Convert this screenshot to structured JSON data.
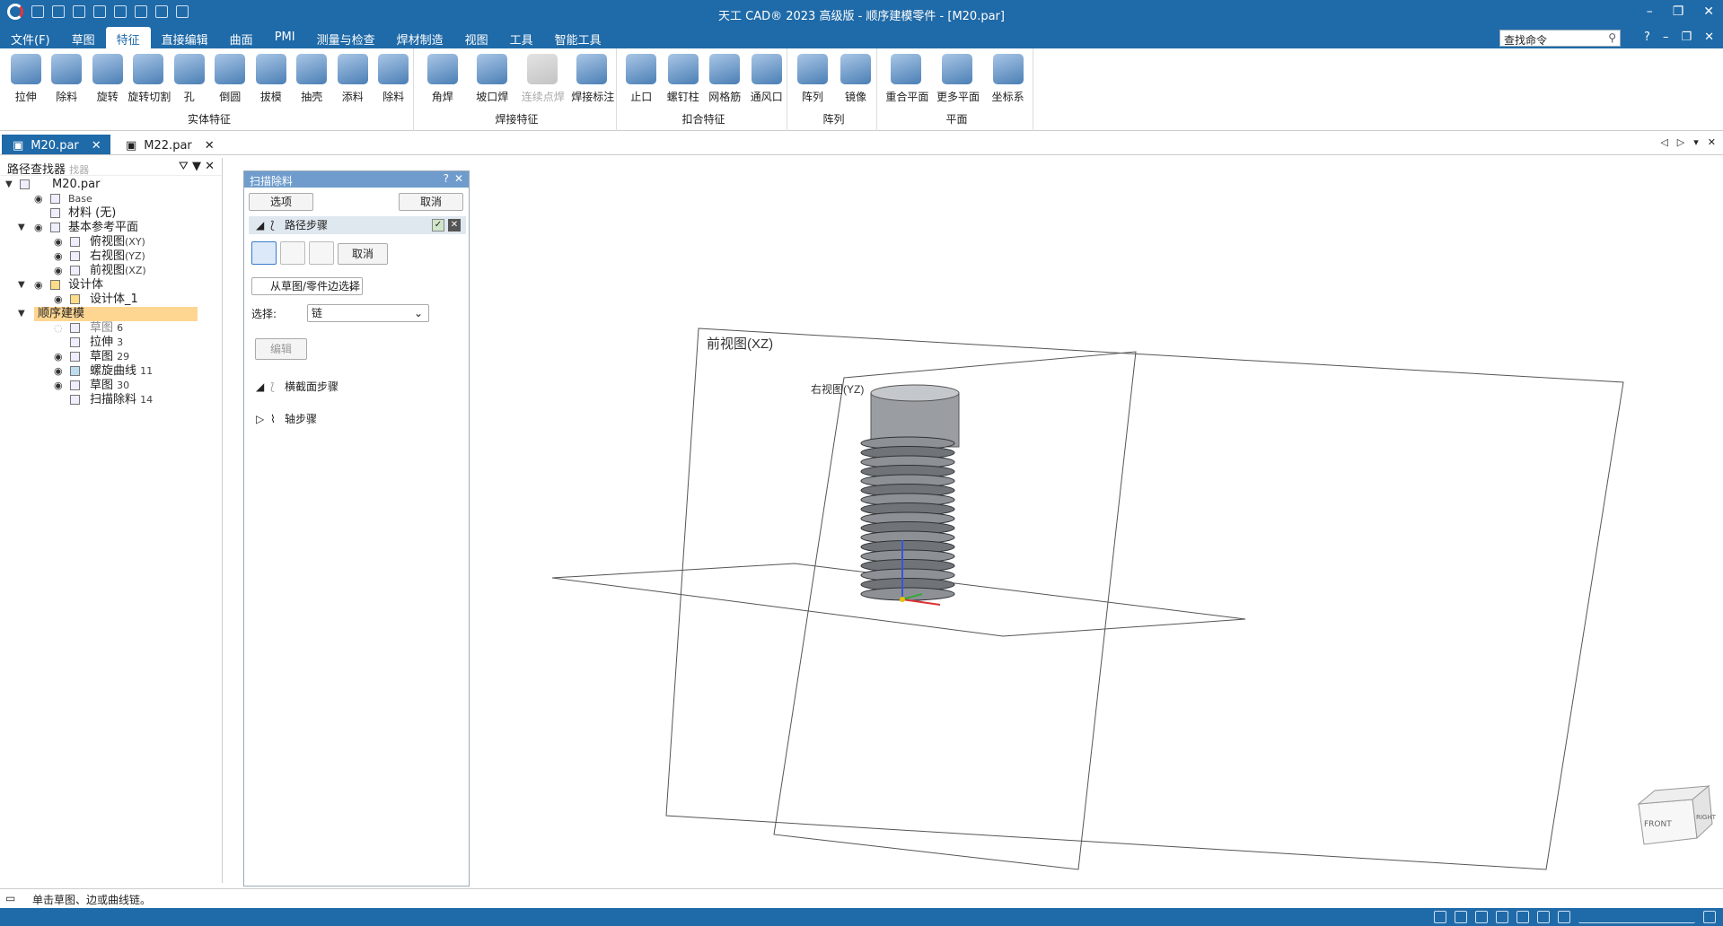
{
  "window": {
    "title": "天工 CAD® 2023 高级版 - 顺序建模零件 - [M20.par]",
    "controls": [
      "–",
      "❐",
      "✕"
    ]
  },
  "menu": {
    "items": [
      "文件(F)",
      "草图",
      "特征",
      "直接编辑",
      "曲面",
      "PMI",
      "测量与检查",
      "焊材制造",
      "视图",
      "工具",
      "智能工具"
    ],
    "active": "特征",
    "search_placeholder": "查找命令",
    "right": [
      "?",
      "–",
      "❐",
      "✕"
    ]
  },
  "ribbon": {
    "groups": [
      {
        "label": "实体特征",
        "tools": [
          "拉伸",
          "除料",
          "旋转",
          "旋转切割",
          "孔",
          "倒圆",
          "拔模",
          "抽壳",
          "添料",
          "除料"
        ]
      },
      {
        "label": "焊接特征",
        "tools": [
          "角焊",
          "坡口焊",
          "连续点焊",
          "焊接标注"
        ]
      },
      {
        "label": "扣合特征",
        "tools": [
          "止口",
          "螺钉柱",
          "网格筋",
          "通风口"
        ]
      },
      {
        "label": "阵列",
        "tools": [
          "阵列",
          "镜像"
        ]
      },
      {
        "label": "平面",
        "tools": [
          "重合平面",
          "更多平面",
          "坐标系"
        ]
      }
    ]
  },
  "doc_tabs": [
    {
      "label": "M20.par",
      "active": true
    },
    {
      "label": "M22.par",
      "active": false
    }
  ],
  "pathfinder": {
    "title": "路径查找器",
    "title_ghost": "找器",
    "tree": {
      "root": "M20.par",
      "base": "Base",
      "material": "材料 (无)",
      "ref_planes": "基本参考平面",
      "top_view": "俯视图",
      "top_view_sub": "(XY)",
      "right_view": "右视图",
      "right_view_sub": "(YZ)",
      "front_view": "前视图",
      "front_view_sub": "(XZ)",
      "design_body": "设计体",
      "design_body_1": "设计体_1",
      "sequential": "顺序建模",
      "sketch6": "草图",
      "sketch6_num": "6",
      "extrude3": "拉伸",
      "extrude3_num": "3",
      "sketch29": "草图",
      "sketch29_num": "29",
      "helix11": "螺旋曲线",
      "helix11_num": "11",
      "sketch30": "草图",
      "sketch30_num": "30",
      "sweep14": "扫描除料",
      "sweep14_num": "14"
    }
  },
  "sweep_panel": {
    "title": "扫描除料",
    "options_btn": "选项",
    "cancel_btn": "取消",
    "path_step": "路径步骤",
    "inner_cancel": "取消",
    "select_mode": "从草图/零件边选择",
    "select_label": "选择:",
    "select_value": "链",
    "edit_btn": "编辑",
    "cross_section_step": "横截面步骤",
    "axis_step": "轴步骤"
  },
  "viewport": {
    "front_plane_label": "前视图(XZ)",
    "right_plane_label": "右视图(YZ)",
    "cube_front": "FRONT",
    "cube_right": "RIGHT"
  },
  "status": {
    "prompt": "单击草图、边或曲线链。"
  }
}
